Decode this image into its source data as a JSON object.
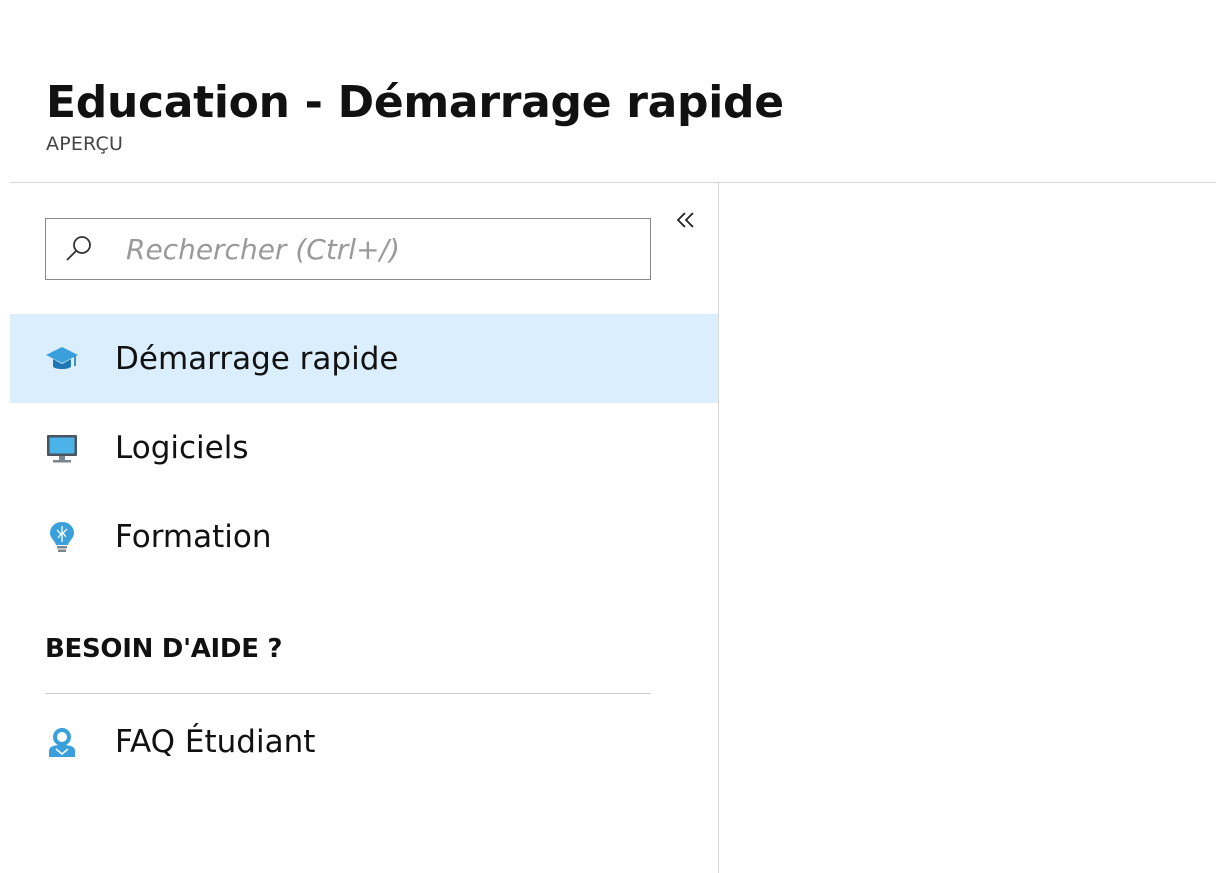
{
  "header": {
    "title": "Education - Démarrage rapide",
    "subtitle": "APERÇU"
  },
  "sidebar": {
    "collapse_icon": "double-chevron-left-icon",
    "search": {
      "placeholder": "Rechercher (Ctrl+/)",
      "value": ""
    },
    "items": [
      {
        "label": "Démarrage rapide",
        "icon": "graduation-cap-icon",
        "active": true
      },
      {
        "label": "Logiciels",
        "icon": "monitor-icon",
        "active": false
      },
      {
        "label": "Formation",
        "icon": "lightbulb-icon",
        "active": false
      }
    ],
    "help_section": {
      "heading": "BESOIN D'AIDE ?",
      "items": [
        {
          "label": "FAQ Étudiant",
          "icon": "student-support-icon"
        }
      ]
    }
  },
  "colors": {
    "active_item_background": "#dbeefd",
    "icon_blue": "#3aa0dc",
    "divider": "#d6d6d6"
  }
}
